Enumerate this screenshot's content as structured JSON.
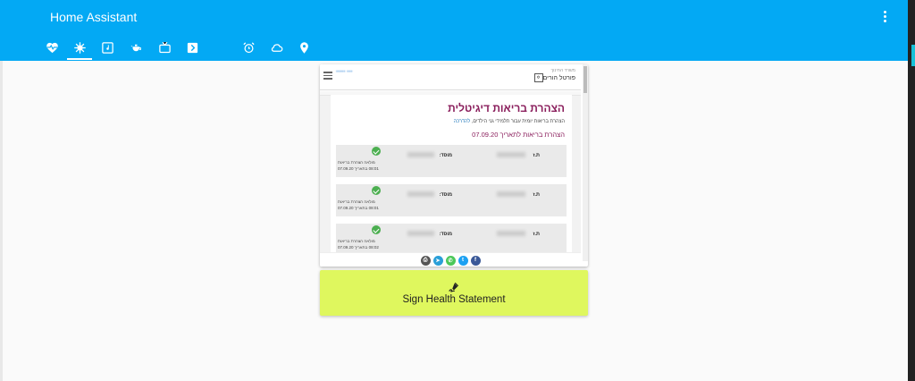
{
  "app": {
    "title": "Home Assistant"
  },
  "tabs": [
    {
      "name": "tab-health",
      "icon": "heart-pulse-icon"
    },
    {
      "name": "tab-virus",
      "icon": "virus-icon",
      "active": true
    },
    {
      "name": "tab-media",
      "icon": "music-box-icon"
    },
    {
      "name": "tab-kitchen",
      "icon": "teapot-icon"
    },
    {
      "name": "tab-tv",
      "icon": "tv-icon"
    },
    {
      "name": "tab-console",
      "icon": "console-icon"
    },
    {
      "name": "tab-alarm",
      "icon": "alarm-clock-icon"
    },
    {
      "name": "tab-weather",
      "icon": "cloud-icon"
    },
    {
      "name": "tab-location",
      "icon": "map-marker-icon"
    }
  ],
  "iframe": {
    "portal_small": "משרד החינוך",
    "portal_title": "פורטל הורים",
    "heading": "הצהרת בריאות דיגיטלית",
    "subtitle": "הצהרת בריאות יומית עבור תלמידי גני הילדים,",
    "subtitle_link": "להדרכה",
    "date_line": "הצהרת בריאות לתאריך 07.09.20",
    "kids": [
      {
        "id_label": "ת.ז",
        "school_label": "מוסד:",
        "filled_1": "מולאה הצהרת בריאות",
        "filled_2": "בתאריך 07.09.20",
        "time": "08:01"
      },
      {
        "id_label": "ת.ז",
        "school_label": "מוסד:",
        "filled_1": "מולאה הצהרת בריאות",
        "filled_2": "בתאריך 07.09.20",
        "time": "08:01"
      },
      {
        "id_label": "ת.ז",
        "school_label": "מוסד:",
        "filled_1": "מולאה הצהרת בריאות",
        "filled_2": "בתאריך 07.09.20",
        "time": "08:02"
      }
    ],
    "share": [
      "print-icon",
      "telegram-icon",
      "whatsapp-icon",
      "twitter-icon",
      "facebook-icon"
    ]
  },
  "sign_button": {
    "label": "Sign Health Statement",
    "icon": "pen-signature-icon"
  },
  "colors": {
    "header": "#03a9f4",
    "button": "#dff75e",
    "heading": "#8a1e5c",
    "check": "#4caf50"
  }
}
